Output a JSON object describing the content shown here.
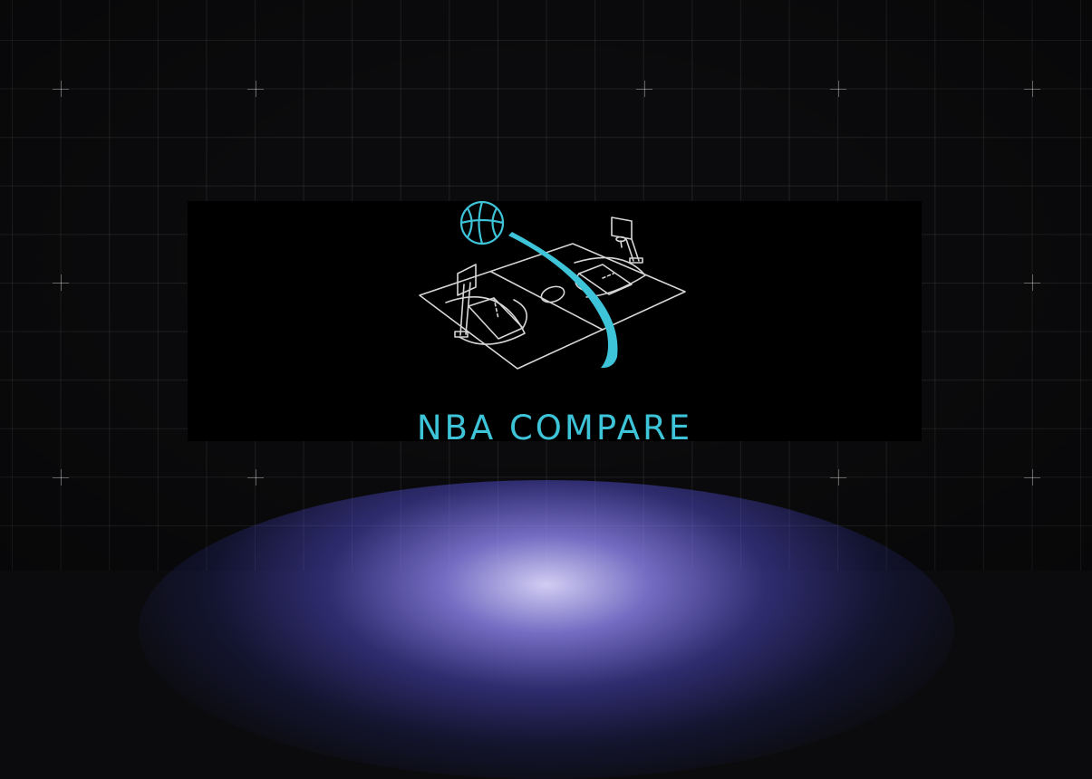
{
  "logo": {
    "title": "NBA COMPARE",
    "accent_color": "#3ec4d8",
    "line_color": "#d6d6d6",
    "icons": [
      "basketball-icon",
      "basketball-court-icon",
      "hoop-icon"
    ]
  },
  "background": {
    "base_color": "#0b0b0d",
    "grid_color": "#ffffff",
    "glow_color": "#8a84ff"
  }
}
